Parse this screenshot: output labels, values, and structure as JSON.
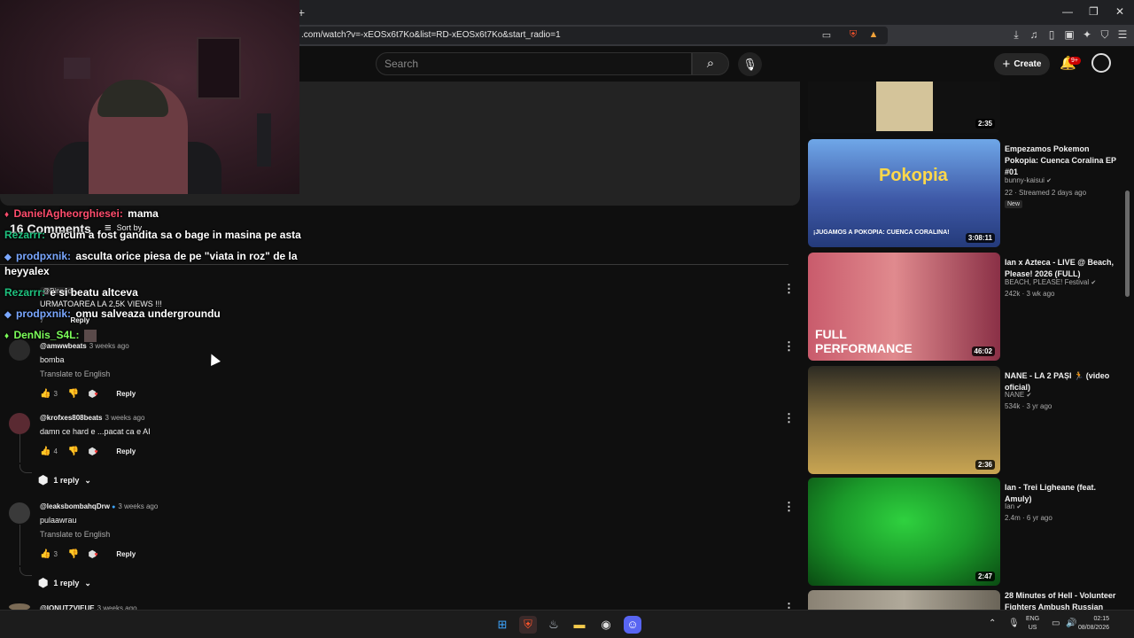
{
  "browser": {
    "url": ".com/watch?v=-xEOSx6t7Ko&list=RD-xEOSx6t7Ko&start_radio=1",
    "new_tab_symbol": "+",
    "window_controls": [
      "—",
      "❐",
      "✕"
    ]
  },
  "header": {
    "search_placeholder": "Search",
    "create_label": "Create",
    "notifications_count": "9+"
  },
  "comments": {
    "count_label": "16 Comments",
    "sort_label": "Sort by",
    "pinned": {
      "label": "@Pinned",
      "text": "URMATOAREA LA 2,5K VIEWS !!!",
      "likes": "7",
      "reply_label": "Reply"
    },
    "items": [
      {
        "author": "@amwwbeats",
        "time": "3 weeks ago",
        "text": "bomba",
        "translate": "Translate to English",
        "likes": "3",
        "reply_label": "Reply",
        "avatar_color": "#2b2b2b"
      },
      {
        "author": "@krofxes808beats",
        "time": "3 weeks ago",
        "text": "damn ce hard e ...pacat ca e AI",
        "likes": "4",
        "reply_label": "Reply",
        "replies": "1 reply",
        "avatar_color": "#5a2a32"
      },
      {
        "author": "@leaksbombahqDrw",
        "time": "3 weeks ago",
        "text": "pulaawrau",
        "translate": "Translate to English",
        "likes": "3",
        "reply_label": "Reply",
        "replies": "1 reply",
        "avatar_color": "#3a3a3a"
      },
      {
        "author": "@IONUTZVIEUE",
        "time": "3 weeks ago",
        "avatar_color": "#7a6a55"
      }
    ]
  },
  "chat": [
    {
      "user": "DanielAgheorghiesei:",
      "text": "mama",
      "color": "#ff4d6d",
      "icon": "♦"
    },
    {
      "user": "Rezarrr:",
      "text": "oricum a fost gandita sa o bage in masina pe asta",
      "color": "#1fc27f",
      "icon": ""
    },
    {
      "user": "prodpxnik:",
      "text": "asculta orice piesa de pe \"viata in roz\" de la",
      "color": "#7aa7ff",
      "icon": "◆"
    },
    {
      "user": "",
      "text": "heyyalex",
      "color": "#ffffff",
      "icon": ""
    },
    {
      "user": "Rezarrr:",
      "text": "e si beatu altceva",
      "color": "#1fc27f",
      "icon": ""
    },
    {
      "user": "prodpxnik:",
      "text": "omu salveaza undergroundu",
      "color": "#7aa7ff",
      "icon": "◆"
    },
    {
      "user": "DenNis_S4L:",
      "text": "",
      "color": "#7cff5a",
      "icon": "♦"
    }
  ],
  "recommendations": [
    {
      "title": "",
      "channel": "",
      "meta": "",
      "duration": "2:35",
      "thumb_bg": "#1a1a1a"
    },
    {
      "title": "Empezamos Pokemon Pokopia: Cuenca Coralina EP #01",
      "channel": "bunny-kaisui",
      "meta": "22 · Streamed 2 days ago",
      "badge": "New",
      "duration": "3:08:11",
      "thumb_bg": "#3f5aa8",
      "thumb_caption": "¡JUGAMOS A POKOPIA: CUENCA CORALINA!",
      "thumb_logo": "Pokopia"
    },
    {
      "title": "Ian x Azteca - LIVE @ Beach, Please! 2026 (FULL)",
      "channel": "BEACH, PLEASE! Festival",
      "meta": "242k · 3 wk ago",
      "duration": "46:02",
      "thumb_bg": "#b84a5e",
      "thumb_caption": "FULL PERFORMANCE"
    },
    {
      "title": "NANE - LA 2 PAȘI 🏃 (video oficial)",
      "channel": "NANE",
      "meta": "534k · 3 yr ago",
      "duration": "2:36",
      "thumb_bg": "#8a7440"
    },
    {
      "title": "Ian - Trei Ligheane (feat. Amuly)",
      "channel": "Ian",
      "meta": "2.4m · 6 yr ago",
      "duration": "2:47",
      "thumb_bg": "#1b9a2a"
    },
    {
      "title": "28 Minutes of Hell - Volunteer Fighters Ambush Russian",
      "channel": "",
      "meta": "",
      "duration": "",
      "thumb_bg": "#b0a99a"
    }
  ],
  "taskbar": {
    "lang_line1": "ENG",
    "lang_line2": "US",
    "time": "02:15",
    "date": "08/08/2026"
  },
  "colors": {
    "accent_red": "#cc0000",
    "background": "#0f0f0f",
    "verified_blue": "#3ea6ff"
  }
}
